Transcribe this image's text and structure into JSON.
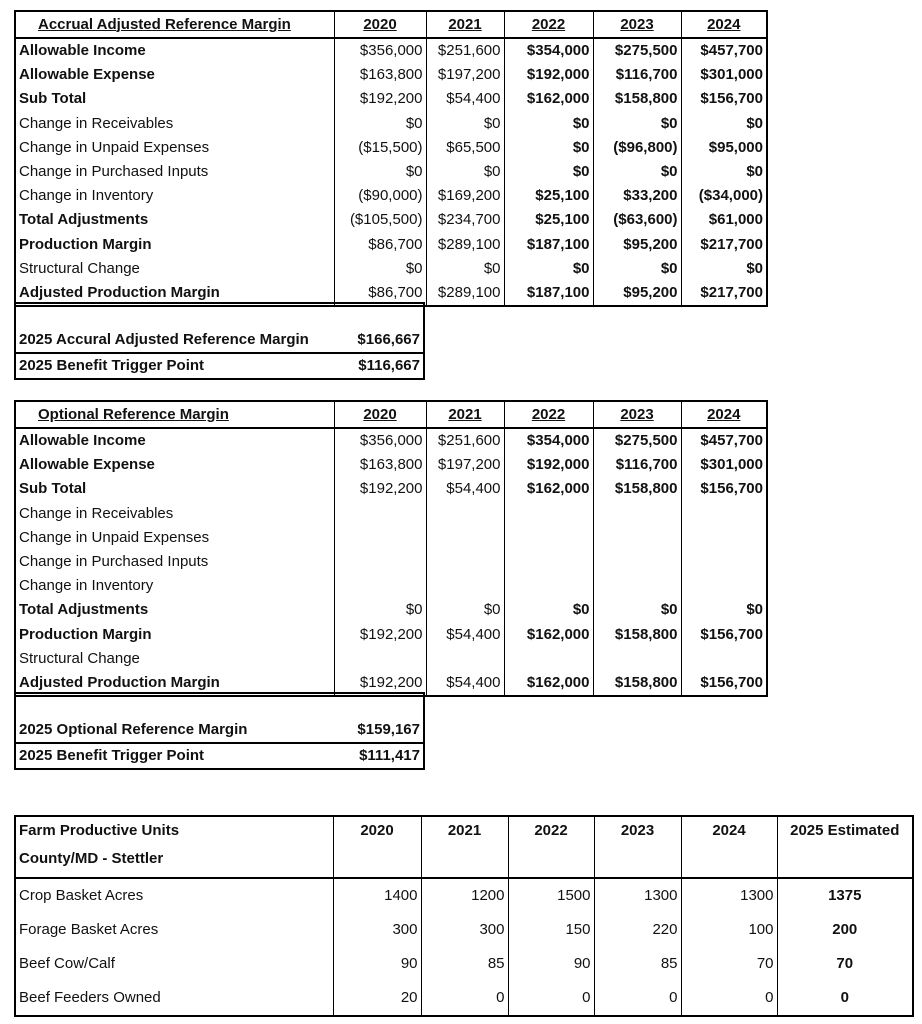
{
  "years": [
    "2020",
    "2021",
    "2022",
    "2023",
    "2024"
  ],
  "accrual": {
    "title": "Accrual Adjusted Reference Margin",
    "rows": [
      {
        "label": "Allowable Income",
        "bold": true,
        "values": [
          "$356,000",
          "$251,600",
          "$354,000",
          "$275,500",
          "$457,700"
        ]
      },
      {
        "label": "Allowable Expense",
        "bold": true,
        "values": [
          "$163,800",
          "$197,200",
          "$192,000",
          "$116,700",
          "$301,000"
        ]
      },
      {
        "label": "Sub Total",
        "bold": true,
        "values": [
          "$192,200",
          "$54,400",
          "$162,000",
          "$158,800",
          "$156,700"
        ]
      },
      {
        "label": "Change in Receivables",
        "bold": false,
        "values": [
          "$0",
          "$0",
          "$0",
          "$0",
          "$0"
        ]
      },
      {
        "label": "Change in Unpaid Expenses",
        "bold": false,
        "values": [
          "($15,500)",
          "$65,500",
          "$0",
          "($96,800)",
          "$95,000"
        ]
      },
      {
        "label": "Change in Purchased Inputs",
        "bold": false,
        "values": [
          "$0",
          "$0",
          "$0",
          "$0",
          "$0"
        ]
      },
      {
        "label": "Change in Inventory",
        "bold": false,
        "values": [
          "($90,000)",
          "$169,200",
          "$25,100",
          "$33,200",
          "($34,000)"
        ]
      },
      {
        "label": "Total Adjustments",
        "bold": true,
        "values": [
          "($105,500)",
          "$234,700",
          "$25,100",
          "($63,600)",
          "$61,000"
        ]
      },
      {
        "label": "Production Margin",
        "bold": true,
        "values": [
          "$86,700",
          "$289,100",
          "$187,100",
          "$95,200",
          "$217,700"
        ]
      },
      {
        "label": "Structural Change",
        "bold": false,
        "values": [
          "$0",
          "$0",
          "$0",
          "$0",
          "$0"
        ]
      },
      {
        "label": "Adjusted Production Margin",
        "bold": true,
        "values": [
          "$86,700",
          "$289,100",
          "$187,100",
          "$95,200",
          "$217,700"
        ]
      }
    ],
    "summary": [
      {
        "label": "2025 Accural Adjusted Reference Margin",
        "value": "$166,667"
      },
      {
        "label": "2025 Benefit Trigger Point",
        "value": "$116,667"
      }
    ]
  },
  "optional": {
    "title": "Optional Reference Margin",
    "rows": [
      {
        "label": "Allowable Income",
        "bold": true,
        "values": [
          "$356,000",
          "$251,600",
          "$354,000",
          "$275,500",
          "$457,700"
        ]
      },
      {
        "label": "Allowable Expense",
        "bold": true,
        "values": [
          "$163,800",
          "$197,200",
          "$192,000",
          "$116,700",
          "$301,000"
        ]
      },
      {
        "label": "Sub Total",
        "bold": true,
        "values": [
          "$192,200",
          "$54,400",
          "$162,000",
          "$158,800",
          "$156,700"
        ]
      },
      {
        "label": "Change in Receivables",
        "bold": false,
        "values": [
          "",
          "",
          "",
          "",
          ""
        ]
      },
      {
        "label": "Change in Unpaid Expenses",
        "bold": false,
        "values": [
          "",
          "",
          "",
          "",
          ""
        ]
      },
      {
        "label": "Change in Purchased Inputs",
        "bold": false,
        "values": [
          "",
          "",
          "",
          "",
          ""
        ]
      },
      {
        "label": "Change in Inventory",
        "bold": false,
        "values": [
          "",
          "",
          "",
          "",
          ""
        ]
      },
      {
        "label": "Total Adjustments",
        "bold": true,
        "values": [
          "$0",
          "$0",
          "$0",
          "$0",
          "$0"
        ]
      },
      {
        "label": "Production Margin",
        "bold": true,
        "values": [
          "$192,200",
          "$54,400",
          "$162,000",
          "$158,800",
          "$156,700"
        ]
      },
      {
        "label": "Structural Change",
        "bold": false,
        "values": [
          "",
          "",
          "",
          "",
          ""
        ]
      },
      {
        "label": "Adjusted Production Margin",
        "bold": true,
        "values": [
          "$192,200",
          "$54,400",
          "$162,000",
          "$158,800",
          "$156,700"
        ]
      }
    ],
    "summary": [
      {
        "label": "2025 Optional Reference Margin",
        "value": "$159,167"
      },
      {
        "label": "2025 Benefit Trigger Point",
        "value": "$111,417"
      }
    ]
  },
  "units": {
    "title": "Farm Productive Units",
    "subtitle": "County/MD - Stettler",
    "estimated_label": "2025 Estimated",
    "rows": [
      {
        "label": "Crop Basket Acres",
        "values": [
          "1400",
          "1200",
          "1500",
          "1300",
          "1300"
        ],
        "estimated": "1375"
      },
      {
        "label": "Forage Basket Acres",
        "values": [
          "300",
          "300",
          "150",
          "220",
          "100"
        ],
        "estimated": "200"
      },
      {
        "label": "Beef Cow/Calf",
        "values": [
          "90",
          "85",
          "90",
          "85",
          "70"
        ],
        "estimated": "70"
      },
      {
        "label": "Beef Feeders Owned",
        "values": [
          "20",
          "0",
          "0",
          "0",
          "0"
        ],
        "estimated": "0"
      }
    ]
  }
}
